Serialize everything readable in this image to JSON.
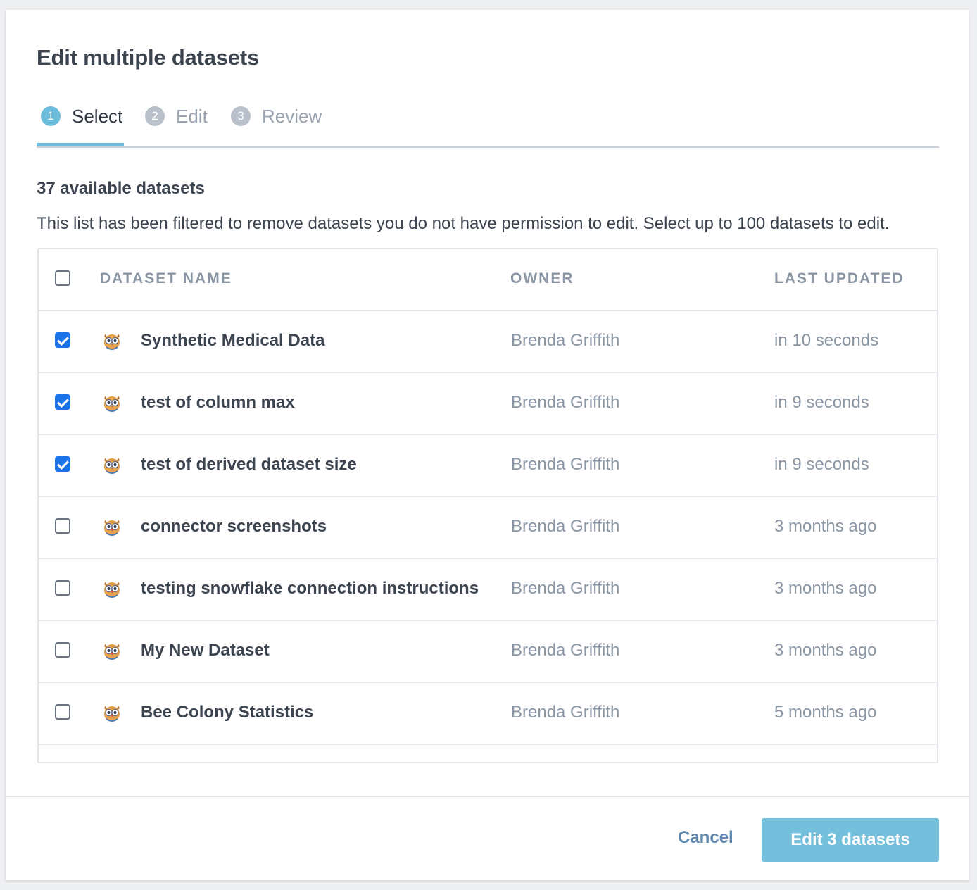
{
  "modal": {
    "title": "Edit multiple datasets"
  },
  "steps": [
    {
      "number": "1",
      "label": "Select",
      "active": true
    },
    {
      "number": "2",
      "label": "Edit",
      "active": false
    },
    {
      "number": "3",
      "label": "Review",
      "active": false
    }
  ],
  "summary": {
    "count_label": "37 available datasets",
    "description": "This list has been filtered to remove datasets you do not have permission to edit. Select up to 100 datasets to edit."
  },
  "table": {
    "columns": [
      "DATASET NAME",
      "OWNER",
      "LAST UPDATED"
    ],
    "select_all_checked": false,
    "rows": [
      {
        "name": "Synthetic Medical Data",
        "owner": "Brenda Griffith",
        "updated": "in 10 seconds",
        "checked": true,
        "icon": "owl-avatar-icon"
      },
      {
        "name": "test of column max",
        "owner": "Brenda Griffith",
        "updated": "in 9 seconds",
        "checked": true,
        "icon": "owl-avatar-icon"
      },
      {
        "name": "test of derived dataset size",
        "owner": "Brenda Griffith",
        "updated": "in 9 seconds",
        "checked": true,
        "icon": "owl-avatar-icon"
      },
      {
        "name": "connector screenshots",
        "owner": "Brenda Griffith",
        "updated": "3 months ago",
        "checked": false,
        "icon": "owl-avatar-icon"
      },
      {
        "name": "testing snowflake connection instructions",
        "owner": "Brenda Griffith",
        "updated": "3 months ago",
        "checked": false,
        "icon": "owl-avatar-icon"
      },
      {
        "name": "My New Dataset",
        "owner": "Brenda Griffith",
        "updated": "3 months ago",
        "checked": false,
        "icon": "owl-avatar-icon"
      },
      {
        "name": "Bee Colony Statistics",
        "owner": "Brenda Griffith",
        "updated": "5 months ago",
        "checked": false,
        "icon": "owl-avatar-icon"
      }
    ]
  },
  "footer": {
    "cancel_label": "Cancel",
    "primary_label": "Edit 3 datasets"
  },
  "colors": {
    "accent": "#6cbcdb",
    "primary_button": "#74c0dc",
    "checkbox_checked": "#1a73e8",
    "link": "#5e87b0"
  }
}
